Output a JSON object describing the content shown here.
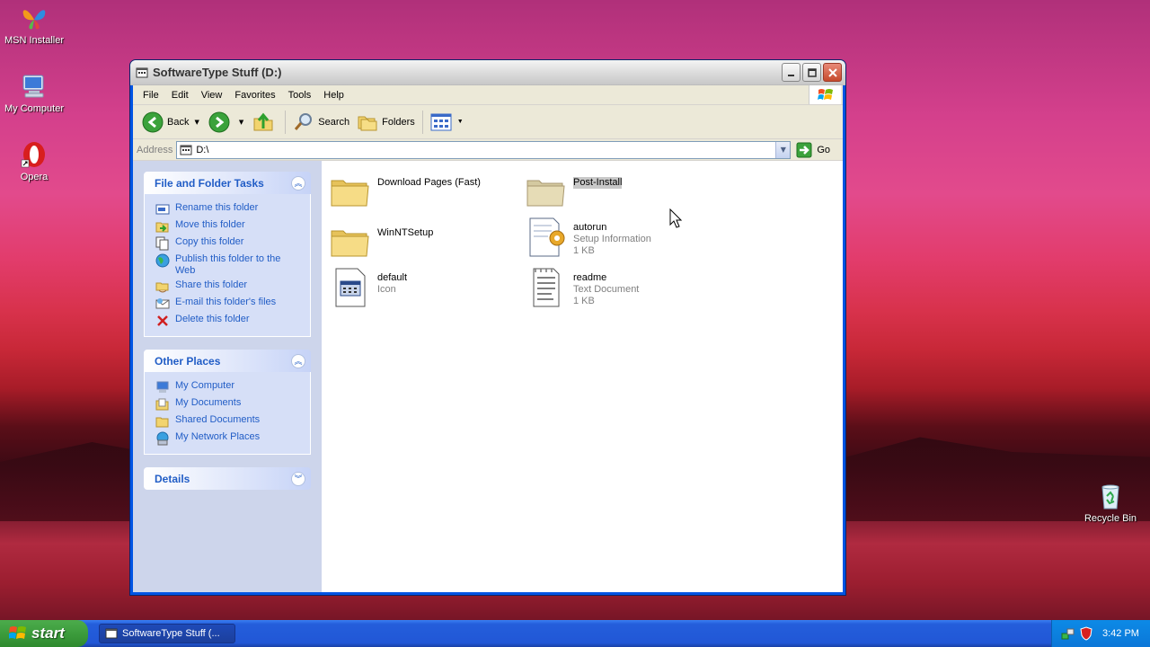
{
  "desktop": {
    "icons": [
      {
        "label": "MSN Installer"
      },
      {
        "label": "My Computer"
      },
      {
        "label": "Opera"
      },
      {
        "label": "Recycle Bin"
      }
    ]
  },
  "window": {
    "title": "SoftwareType Stuff (D:)",
    "menu": [
      "File",
      "Edit",
      "View",
      "Favorites",
      "Tools",
      "Help"
    ],
    "toolbar": {
      "back": "Back",
      "search": "Search",
      "folders": "Folders"
    },
    "address": {
      "label": "Address",
      "value": "D:\\",
      "go": "Go"
    }
  },
  "taskpane": {
    "file_folder_tasks": {
      "title": "File and Folder Tasks",
      "items": [
        "Rename this folder",
        "Move this folder",
        "Copy this folder",
        "Publish this folder to the Web",
        "Share this folder",
        "E-mail this folder's files",
        "Delete this folder"
      ]
    },
    "other_places": {
      "title": "Other Places",
      "items": [
        "My Computer",
        "My Documents",
        "Shared Documents",
        "My Network Places"
      ]
    },
    "details": {
      "title": "Details"
    }
  },
  "files": [
    {
      "name": "Download Pages (Fast)",
      "type": "",
      "size": "",
      "icon": "folder-icon"
    },
    {
      "name": "Post-Install",
      "type": "",
      "size": "",
      "icon": "folder-icon",
      "selected": true
    },
    {
      "name": "WinNTSetup",
      "type": "",
      "size": "",
      "icon": "folder-icon"
    },
    {
      "name": "autorun",
      "type": "Setup Information",
      "size": "1 KB",
      "icon": "setup-info-icon"
    },
    {
      "name": "default",
      "type": "Icon",
      "size": "",
      "icon": "icon-file-icon"
    },
    {
      "name": "readme",
      "type": "Text Document",
      "size": "1 KB",
      "icon": "text-document-icon"
    }
  ],
  "taskbar": {
    "start": "start",
    "task_button": "SoftwareType Stuff (...",
    "clock": "3:42 PM"
  }
}
